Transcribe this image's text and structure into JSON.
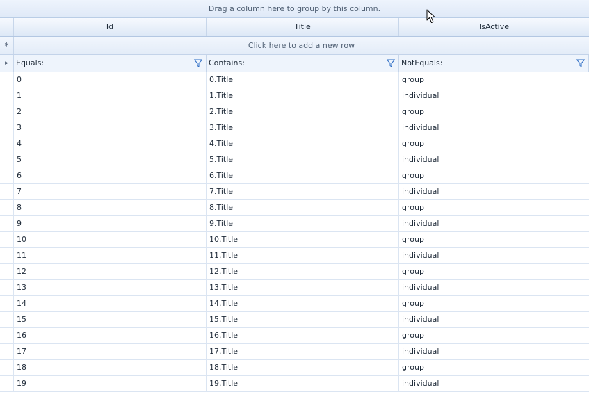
{
  "group_panel": {
    "text": "Drag a column here to group by this column."
  },
  "columns": [
    {
      "header": "Id",
      "filter_operator": "Equals:"
    },
    {
      "header": "Title",
      "filter_operator": "Contains:"
    },
    {
      "header": "IsActive",
      "filter_operator": "NotEquals:"
    }
  ],
  "new_row": {
    "indicator": "*",
    "text": "Click here to add a new row"
  },
  "current_row_indicator": "▸",
  "rows": [
    {
      "id": "0",
      "title": "0.Title",
      "is_active": "group"
    },
    {
      "id": "1",
      "title": "1.Title",
      "is_active": "individual"
    },
    {
      "id": "2",
      "title": "2.Title",
      "is_active": "group"
    },
    {
      "id": "3",
      "title": "3.Title",
      "is_active": "individual"
    },
    {
      "id": "4",
      "title": "4.Title",
      "is_active": "group"
    },
    {
      "id": "5",
      "title": "5.Title",
      "is_active": "individual"
    },
    {
      "id": "6",
      "title": "6.Title",
      "is_active": "group"
    },
    {
      "id": "7",
      "title": "7.Title",
      "is_active": "individual"
    },
    {
      "id": "8",
      "title": "8.Title",
      "is_active": "group"
    },
    {
      "id": "9",
      "title": "9.Title",
      "is_active": "individual"
    },
    {
      "id": "10",
      "title": "10.Title",
      "is_active": "group"
    },
    {
      "id": "11",
      "title": "11.Title",
      "is_active": "individual"
    },
    {
      "id": "12",
      "title": "12.Title",
      "is_active": "group"
    },
    {
      "id": "13",
      "title": "13.Title",
      "is_active": "individual"
    },
    {
      "id": "14",
      "title": "14.Title",
      "is_active": "group"
    },
    {
      "id": "15",
      "title": "15.Title",
      "is_active": "individual"
    },
    {
      "id": "16",
      "title": "16.Title",
      "is_active": "group"
    },
    {
      "id": "17",
      "title": "17.Title",
      "is_active": "individual"
    },
    {
      "id": "18",
      "title": "18.Title",
      "is_active": "group"
    },
    {
      "id": "19",
      "title": "19.Title",
      "is_active": "individual"
    }
  ],
  "icons": {
    "filter": "funnel-icon",
    "cursor": "mouse-pointer-icon"
  },
  "colors": {
    "header_bg": "#dde8f6",
    "grid_line": "#dbe5f2",
    "accent": "#2b6bc4"
  }
}
